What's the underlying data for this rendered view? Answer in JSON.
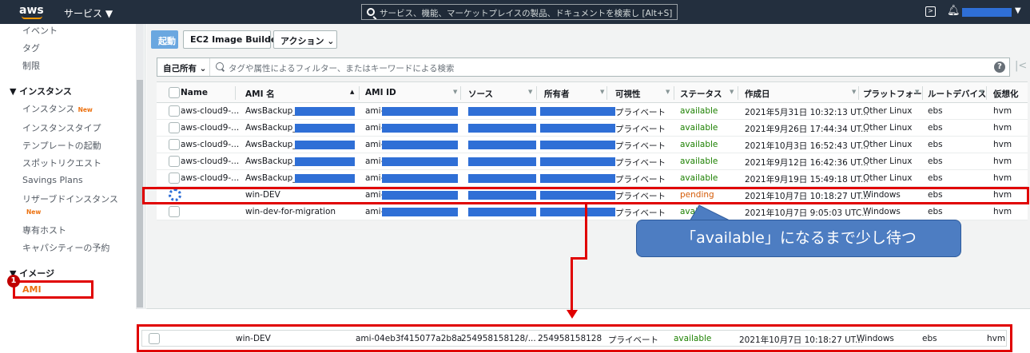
{
  "topnav": {
    "logo": "aws",
    "services_label": "サービス ▼",
    "search_placeholder": "サービス、機能、マーケットプレイスの製品、ドキュメントを検索し  [Alt+S]",
    "caret": "▼"
  },
  "sidebar": {
    "items_top": [
      "イベント",
      "タグ",
      "制限"
    ],
    "section_instances": "▼ インスタンス",
    "instances_items": [
      {
        "label": "インスタンス",
        "badge": "New"
      },
      {
        "label": "インスタンスタイプ"
      },
      {
        "label": "テンプレートの起動"
      },
      {
        "label": "スポットリクエスト"
      },
      {
        "label": "Savings Plans"
      },
      {
        "label": "リザーブドインスタンス"
      }
    ],
    "reserved_new_badge": "New",
    "items_after": [
      "専有ホスト",
      "キャパシティーの予約"
    ],
    "section_images": "▼ イメージ",
    "ami_active": "AMI",
    "step_number": "1"
  },
  "toolbar": {
    "launch_label": "起動",
    "image_builder_label": "EC2 Image Builder",
    "action_label": "アクション ⌄"
  },
  "filter": {
    "owner_label": "自己所有 ⌄",
    "placeholder": "タグや属性によるフィルター、またはキーワードによる検索",
    "help": "?",
    "first_page": "|<"
  },
  "table": {
    "headers": [
      "Name",
      "AMI 名",
      "AMI ID",
      "ソース",
      "所有者",
      "可視性",
      "ステータス",
      "作成日",
      "プラットフォー",
      "ルートデバイス",
      "仮想化"
    ],
    "rows": [
      {
        "name": "aws-cloud9-...",
        "ami_name": "AwsBackup_i-",
        "ami_id": "ami-",
        "visibility": "プライベート",
        "status": "available",
        "created": "2021年5月31日 10:32:13 UT...",
        "platform": "Other Linux",
        "root": "ebs",
        "virt": "hvm"
      },
      {
        "name": "aws-cloud9-...",
        "ami_name": "AwsBackup_i-",
        "ami_id": "ami-",
        "visibility": "プライベート",
        "status": "available",
        "created": "2021年9月26日 17:44:34 UT...",
        "platform": "Other Linux",
        "root": "ebs",
        "virt": "hvm"
      },
      {
        "name": "aws-cloud9-...",
        "ami_name": "AwsBackup_i-",
        "ami_id": "ami-",
        "visibility": "プライベート",
        "status": "available",
        "created": "2021年10月3日 16:52:43 UT...",
        "platform": "Other Linux",
        "root": "ebs",
        "virt": "hvm"
      },
      {
        "name": "aws-cloud9-...",
        "ami_name": "AwsBackup_i-",
        "ami_id": "ami-",
        "visibility": "プライベート",
        "status": "available",
        "created": "2021年9月12日 16:42:36 UT...",
        "platform": "Other Linux",
        "root": "ebs",
        "virt": "hvm"
      },
      {
        "name": "aws-cloud9-...",
        "ami_name": "AwsBackup_i-",
        "ami_id": "ami-",
        "visibility": "プライベート",
        "status": "available",
        "created": "2021年9月19日 15:49:18 UT...",
        "platform": "Other Linux",
        "root": "ebs",
        "virt": "hvm"
      },
      {
        "name": "",
        "ami_name": "win-DEV",
        "ami_id": "ami-",
        "visibility": "プライベート",
        "status": "pending",
        "created": "2021年10月7日 10:18:27 UT...",
        "platform": "Windows",
        "root": "ebs",
        "virt": "hvm"
      },
      {
        "name": "",
        "ami_name": "win-dev-for-migration",
        "ami_id": "ami-",
        "visibility": "プライベート",
        "status": "avail",
        "created": "2021年10月7日 9:05:03 UTC...",
        "platform": "Windows",
        "root": "ebs",
        "virt": "hvm"
      }
    ]
  },
  "callout": {
    "text": "「available」になるまで少し待つ"
  },
  "bottom_row": {
    "ami_name": "win-DEV",
    "ami_id": "ami-04eb3f415077a2b8a",
    "source": "254958158128/...",
    "owner": "254958158128",
    "visibility": "プライベート",
    "status": "available",
    "created": "2021年10月7日 10:18:27 UT...",
    "platform": "Windows",
    "root": "ebs",
    "virt": "hvm"
  },
  "colors": {
    "nav_bg": "#232f3e",
    "accent_orange": "#ec7211",
    "available_green": "#1d8102",
    "pending_orange": "#d45b07",
    "annotation_red": "#e00000",
    "callout_blue": "#4d7dc2",
    "redaction_blue": "#2f6fd6"
  }
}
